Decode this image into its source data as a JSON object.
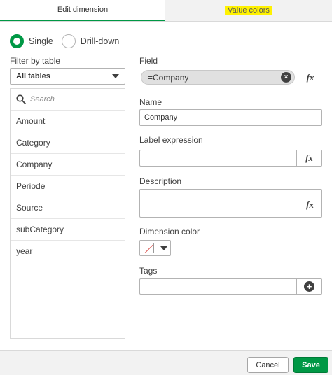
{
  "tabs": [
    {
      "label": "Edit dimension",
      "active": true
    },
    {
      "label": "Value colors",
      "active": false,
      "highlighted": true
    }
  ],
  "mode": {
    "options": [
      "Single",
      "Drill-down"
    ],
    "selected": "Single"
  },
  "filter": {
    "label": "Filter by table",
    "selected": "All tables"
  },
  "search": {
    "placeholder": "Search"
  },
  "fields_list": [
    "Amount",
    "Category",
    "Company",
    "Periode",
    "Source",
    "subCategory",
    "year"
  ],
  "form": {
    "field_label": "Field",
    "field_value": "=Company",
    "fx_label": "fx",
    "name_label": "Name",
    "name_value": "Company",
    "label_expression_label": "Label expression",
    "label_expression_value": "",
    "description_label": "Description",
    "description_value": "",
    "dimension_color_label": "Dimension color",
    "tags_label": "Tags",
    "tags_value": ""
  },
  "footer": {
    "cancel_label": "Cancel",
    "save_label": "Save"
  },
  "colors": {
    "accent": "#009845",
    "highlight": "#fff200"
  }
}
